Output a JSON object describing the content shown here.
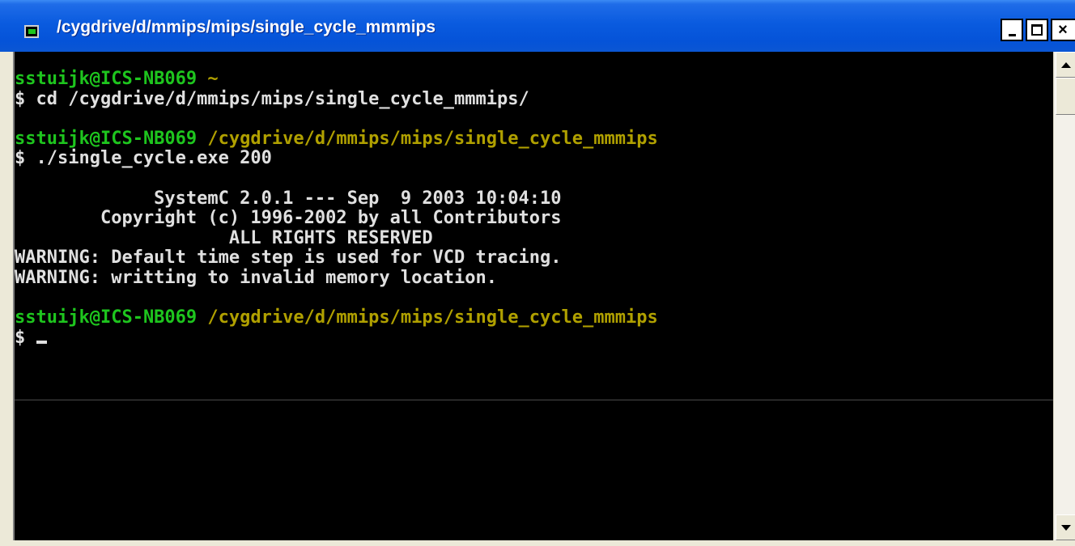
{
  "window": {
    "title": "/cygdrive/d/mmips/mips/single_cycle_mmmips",
    "icon": "cygwin-terminal-icon",
    "buttons": {
      "minimize": "minimize-icon",
      "maximize": "maximize-icon",
      "close": "×"
    }
  },
  "colors": {
    "titlebar": "#0a5bdf",
    "prompt_user": "#1ec51e",
    "prompt_path": "#b0a000",
    "text": "#c0c0c0",
    "background": "#000000"
  },
  "terminal": {
    "lines": [
      {
        "user": "sstuijk@ICS-NB069",
        "path": "~"
      },
      {
        "text": "$ cd /cygdrive/d/mmips/mips/single_cycle_mmmips/"
      },
      {
        "text": ""
      },
      {
        "user": "sstuijk@ICS-NB069",
        "path": "/cygdrive/d/mmips/mips/single_cycle_mmmips"
      },
      {
        "text": "$ ./single_cycle.exe 200"
      },
      {
        "text": ""
      },
      {
        "text": "             SystemC 2.0.1 --- Sep  9 2003 10:04:10"
      },
      {
        "text": "        Copyright (c) 1996-2002 by all Contributors"
      },
      {
        "text": "                    ALL RIGHTS RESERVED"
      },
      {
        "text": "WARNING: Default time step is used for VCD tracing."
      },
      {
        "text": "WARNING: writting to invalid memory location."
      },
      {
        "text": ""
      },
      {
        "user": "sstuijk@ICS-NB069",
        "path": "/cygdrive/d/mmips/mips/single_cycle_mmmips"
      },
      {
        "text": "$ ",
        "cursor": true
      }
    ]
  },
  "scrollbar": {
    "up": "scroll-up-arrow-icon",
    "down": "scroll-down-arrow-icon"
  }
}
